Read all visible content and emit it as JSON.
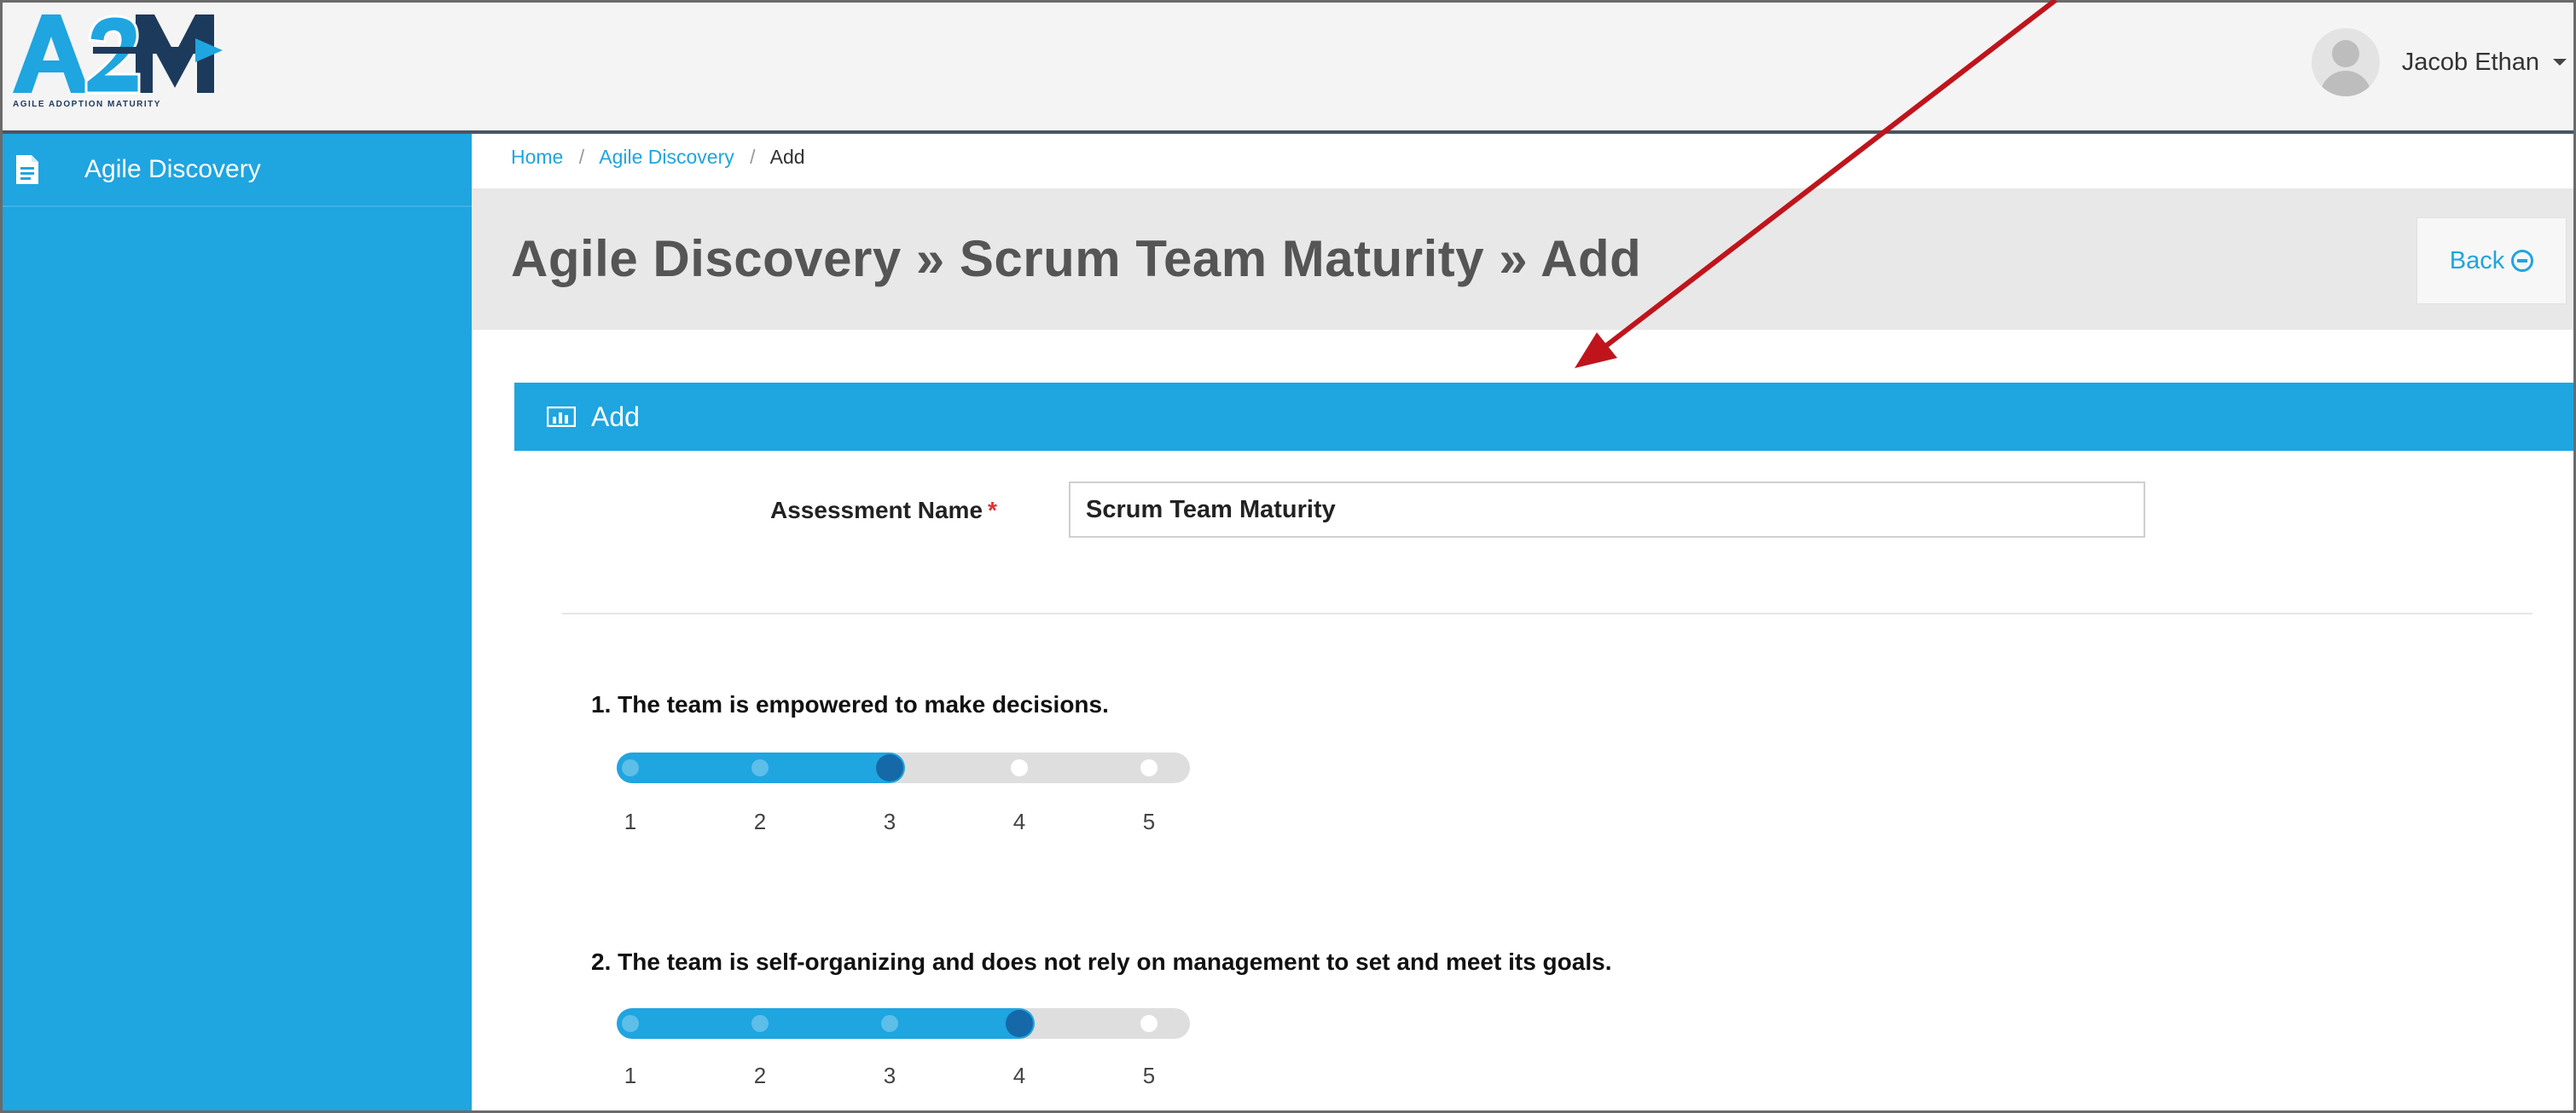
{
  "app": {
    "logo_text": "A2M",
    "logo_tagline": "AGILE ADOPTION MATURITY"
  },
  "user": {
    "name": "Jacob Ethan",
    "avatar_icon": "user-avatar-icon",
    "menu_icon": "caret-down-icon"
  },
  "sidebar": {
    "items": [
      {
        "label": "Agile Discovery",
        "icon": "document-icon"
      }
    ]
  },
  "breadcrumb": {
    "home": "Home",
    "section": "Agile Discovery",
    "current": "Add",
    "separator": "/"
  },
  "page": {
    "title": "Agile Discovery » Scrum Team Maturity » Add",
    "back_label": "Back",
    "back_icon": "circle-minus-icon"
  },
  "panel": {
    "title": "Add",
    "icon": "chart-icon"
  },
  "form": {
    "assessment_label": "Assessment Name",
    "required_marker": "*",
    "assessment_value": "Scrum Team Maturity"
  },
  "questions": [
    {
      "text": "1. The team is empowered to make decisions.",
      "value": 3,
      "scale": [
        "1",
        "2",
        "3",
        "4",
        "5"
      ]
    },
    {
      "text": "2. The team is self-organizing and does not rely on management to set and meet its goals.",
      "value": 4,
      "scale": [
        "1",
        "2",
        "3",
        "4",
        "5"
      ]
    }
  ],
  "colors": {
    "accent": "#1fa5e0",
    "knob": "#1569a8",
    "track": "#dedede",
    "annotation_arrow": "#c0141c",
    "required": "#e03030"
  }
}
